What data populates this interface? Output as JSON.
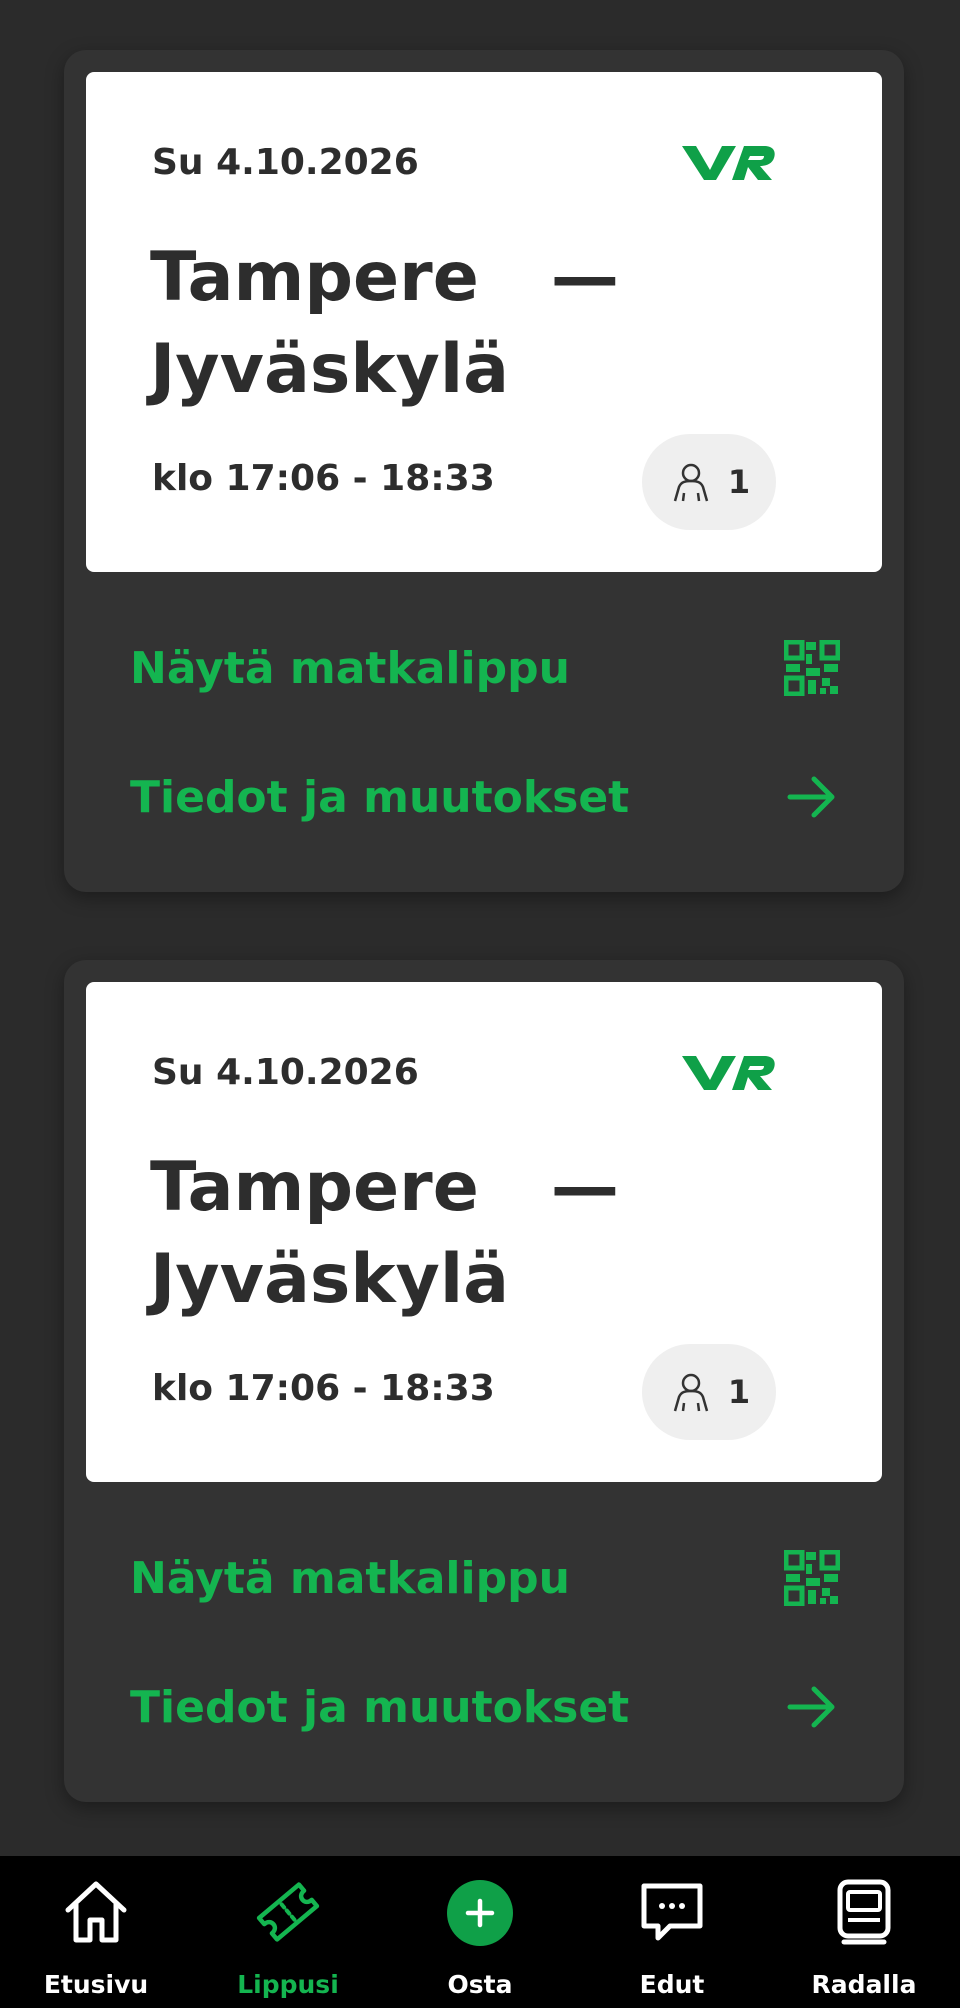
{
  "tickets": [
    {
      "date": "Su 4.10.2026",
      "from": "Tampere",
      "dash": "—",
      "to": "Jyväskylä",
      "time": "klo 17:06 - 18:33",
      "passengers": "1",
      "show_ticket_label": "Näytä matkalippu",
      "details_label": "Tiedot ja muutokset"
    },
    {
      "date": "Su 4.10.2026",
      "from": "Tampere",
      "dash": "—",
      "to": "Jyväskylä",
      "time": "klo 17:06 - 18:33",
      "passengers": "1",
      "show_ticket_label": "Näytä matkalippu",
      "details_label": "Tiedot ja muutokset"
    }
  ],
  "tabbar": {
    "items": [
      {
        "label": "Etusivu",
        "icon": "home-icon",
        "active": false
      },
      {
        "label": "Lippusi",
        "icon": "ticket-icon",
        "active": true
      },
      {
        "label": "Osta",
        "icon": "plus-circle-icon",
        "active": false
      },
      {
        "label": "Edut",
        "icon": "chat-bubble-icon",
        "active": false
      },
      {
        "label": "Radalla",
        "icon": "train-icon",
        "active": false
      }
    ]
  },
  "colors": {
    "brand_green": "#14b550",
    "background": "#2b2b2b",
    "card": "#333333",
    "ticket_face": "#ffffff"
  }
}
